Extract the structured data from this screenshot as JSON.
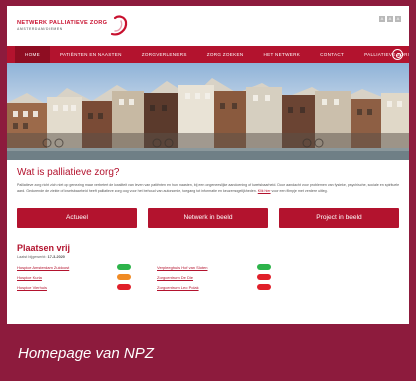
{
  "logo": {
    "line1": "NETWERK",
    "line2": "PALLIATIEVE ZORG",
    "line3": "AMSTERDAM/DIEMEN"
  },
  "font_size_controls": [
    "A",
    "A",
    "A"
  ],
  "nav": {
    "items": [
      "HOME",
      "PATIËNTEN EN NAASTEN",
      "ZORGVERLENERS",
      "ZORG ZOEKEN",
      "HET NETWERK",
      "CONTACT",
      "PALLIATIEVE ZORG"
    ],
    "active_index": 0
  },
  "main": {
    "title": "Wat is palliatieve zorg?",
    "intro": "Palliatieve zorg richt zich niet op genezing maar verbetert de kwaliteit van leven van patiënten en hun naasten, bij een ongeneeslijke aandoening of kwetsbaarheid. Door aandacht voor problemen van fysieke, psychische, sociale en spirituele aard. Gedurende de ziekte of kwetsbaarheid heeft palliatieve zorg oog voor het behoud van autonomie, toegang tot informatie en keuzemogelijkheden.",
    "intro_link": "Klik hier",
    "intro_after": "voor een filmpje met verdere uitleg."
  },
  "cta": {
    "actueel": "Actueel",
    "netwerk": "Netwerk in beeld",
    "project": "Project in beeld"
  },
  "places": {
    "title": "Plaatsen vrij",
    "updated_label": "Laatst bijgewerkt:",
    "updated_value": "17-3-2020",
    "rows": [
      {
        "left": "Hospice Amsterdam Zuidoost",
        "left_status": "#2db34a",
        "right": "Verpleeghuis Hof van Sloten",
        "right_status": "#2db34a"
      },
      {
        "left": "Hospice Kuria",
        "left_status": "#f08a24",
        "right": "Zorgcentrum De Die",
        "right_status": "#e0202a"
      },
      {
        "left": "Hospice Vierhuis",
        "left_status": "#e0202a",
        "right": "Zorgcentrum Leo Polak",
        "right_status": "#e0202a"
      }
    ]
  },
  "caption": "Homepage van NPZ",
  "colors": {
    "brand": "#b3132e",
    "frame": "#8d1b3d"
  }
}
